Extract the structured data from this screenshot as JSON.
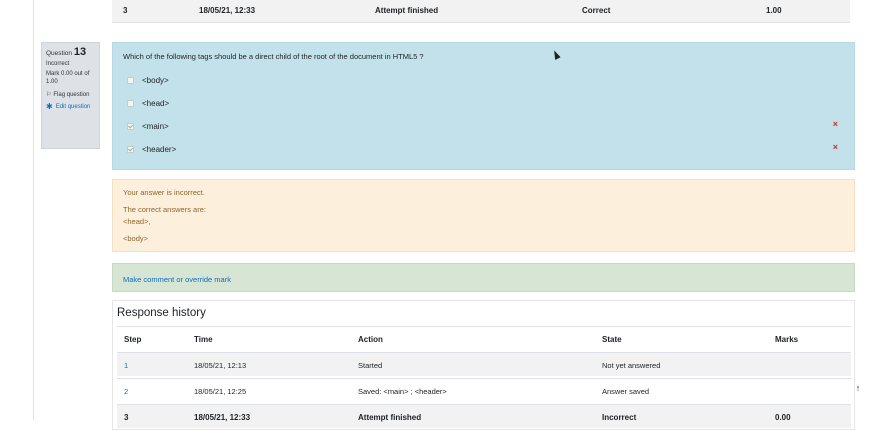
{
  "top_row": {
    "step": "3",
    "time": "18/05/21, 12:33",
    "action": "Attempt finished",
    "state": "Correct",
    "marks": "1.00"
  },
  "info": {
    "question_label": "Question",
    "question_number": "13",
    "status": "Incorrect",
    "mark": "Mark 0.00 out of 1.00",
    "flag": "Flag question",
    "edit": "Edit question"
  },
  "question": {
    "text": "Which of the following tags should be a direct child of the root of the document in HTML5 ?",
    "options": [
      {
        "label": "<body>",
        "checked": false,
        "wrong": false
      },
      {
        "label": "<head>",
        "checked": false,
        "wrong": false
      },
      {
        "label": "<main>",
        "checked": true,
        "wrong": true
      },
      {
        "label": "<header>",
        "checked": true,
        "wrong": true
      }
    ],
    "wrong_mark": "×"
  },
  "feedback": {
    "incorrect": "Your answer is incorrect.",
    "correct_intro": "The correct answers are:",
    "answer1": "<head>,",
    "answer2": "<body>"
  },
  "comment_link": "Make comment or override mark",
  "history": {
    "title": "Response history",
    "headers": {
      "step": "Step",
      "time": "Time",
      "action": "Action",
      "state": "State",
      "marks": "Marks"
    },
    "rows": [
      {
        "step": "1",
        "time": "18/05/21, 12:13",
        "action": "Started",
        "state": "Not yet answered",
        "marks": ""
      },
      {
        "step": "2",
        "time": "18/05/21, 12:25",
        "action": "Saved: <main> ; <header>",
        "state": "Answer saved",
        "marks": ""
      },
      {
        "step": "3",
        "time": "18/05/21, 12:33",
        "action": "Attempt finished",
        "state": "Incorrect",
        "marks": "0.00"
      }
    ]
  },
  "scroll_top_glyph": "↑"
}
